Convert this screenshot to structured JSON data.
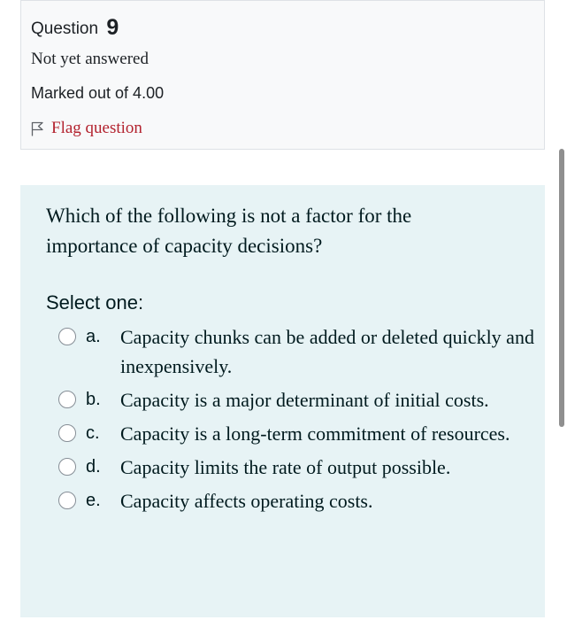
{
  "info": {
    "question_label": "Question",
    "question_number": "9",
    "state": "Not yet answered",
    "grade": "Marked out of 4.00",
    "flag_label": "Flag question"
  },
  "question": {
    "text": "Which of the following is not a factor for the importance of capacity decisions?",
    "prompt": "Select one:",
    "options": [
      {
        "letter": "a.",
        "text": "Capacity chunks can be added or deleted quickly and inexpensively."
      },
      {
        "letter": "b.",
        "text": "Capacity is a major determinant of initial costs."
      },
      {
        "letter": "c.",
        "text": "Capacity is a long-term commitment of resources."
      },
      {
        "letter": "d.",
        "text": "Capacity limits the rate of output possible."
      },
      {
        "letter": "e.",
        "text": "Capacity affects operating costs."
      }
    ]
  },
  "icons": {
    "flag": "flag-outline-icon",
    "radio": "radio-unchecked-icon"
  },
  "colors": {
    "info_background": "#f8f9fa",
    "content_background": "#e7f3f5",
    "flag_text": "#b3232f",
    "radio_border": "#868e96"
  }
}
